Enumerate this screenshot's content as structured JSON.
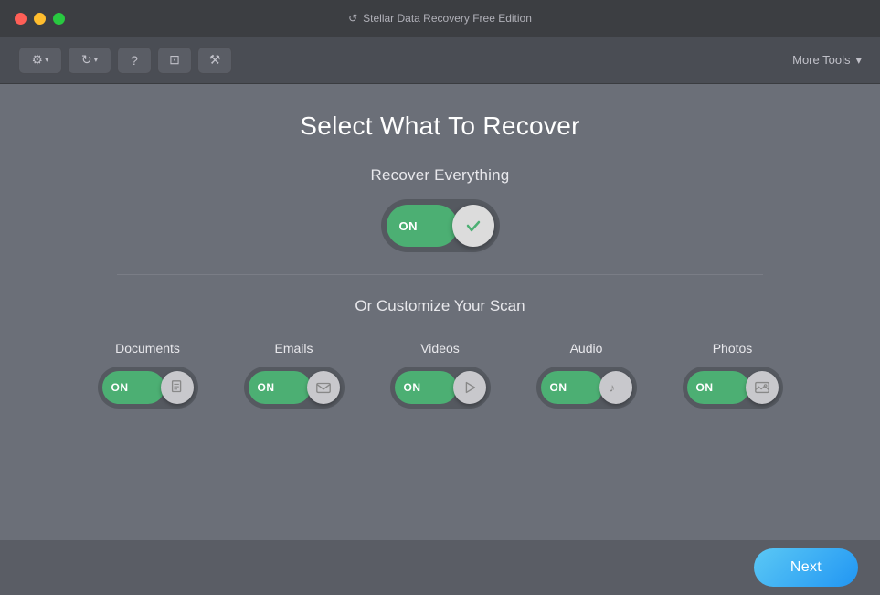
{
  "titleBar": {
    "title": "Stellar Data Recovery Free Edition",
    "trafficLights": [
      "red",
      "yellow",
      "green"
    ]
  },
  "toolbar": {
    "buttons": [
      {
        "name": "settings-button",
        "label": "⚙",
        "hasDropdown": true
      },
      {
        "name": "refresh-button",
        "label": "↺",
        "hasDropdown": true
      },
      {
        "name": "help-button",
        "label": "?",
        "hasDropdown": false
      },
      {
        "name": "cart-button",
        "label": "🛒",
        "hasDropdown": false
      },
      {
        "name": "tools-button",
        "label": "🔧",
        "hasDropdown": false
      }
    ],
    "moreTools": "More Tools"
  },
  "main": {
    "pageTitle": "Select What To Recover",
    "recoverEverything": {
      "label": "Recover Everything",
      "toggleOn": "ON",
      "toggleState": true
    },
    "divider": true,
    "customizeSection": {
      "label": "Or Customize Your Scan",
      "categories": [
        {
          "id": "documents",
          "label": "Documents",
          "toggleOn": "ON",
          "state": true,
          "icon": "document"
        },
        {
          "id": "emails",
          "label": "Emails",
          "toggleOn": "ON",
          "state": true,
          "icon": "email"
        },
        {
          "id": "videos",
          "label": "Videos",
          "toggleOn": "ON",
          "state": true,
          "icon": "video"
        },
        {
          "id": "audio",
          "label": "Audio",
          "toggleOn": "ON",
          "state": true,
          "icon": "audio"
        },
        {
          "id": "photos",
          "label": "Photos",
          "toggleOn": "ON",
          "state": true,
          "icon": "photo"
        }
      ]
    }
  },
  "bottomBar": {
    "nextButton": "Next"
  }
}
